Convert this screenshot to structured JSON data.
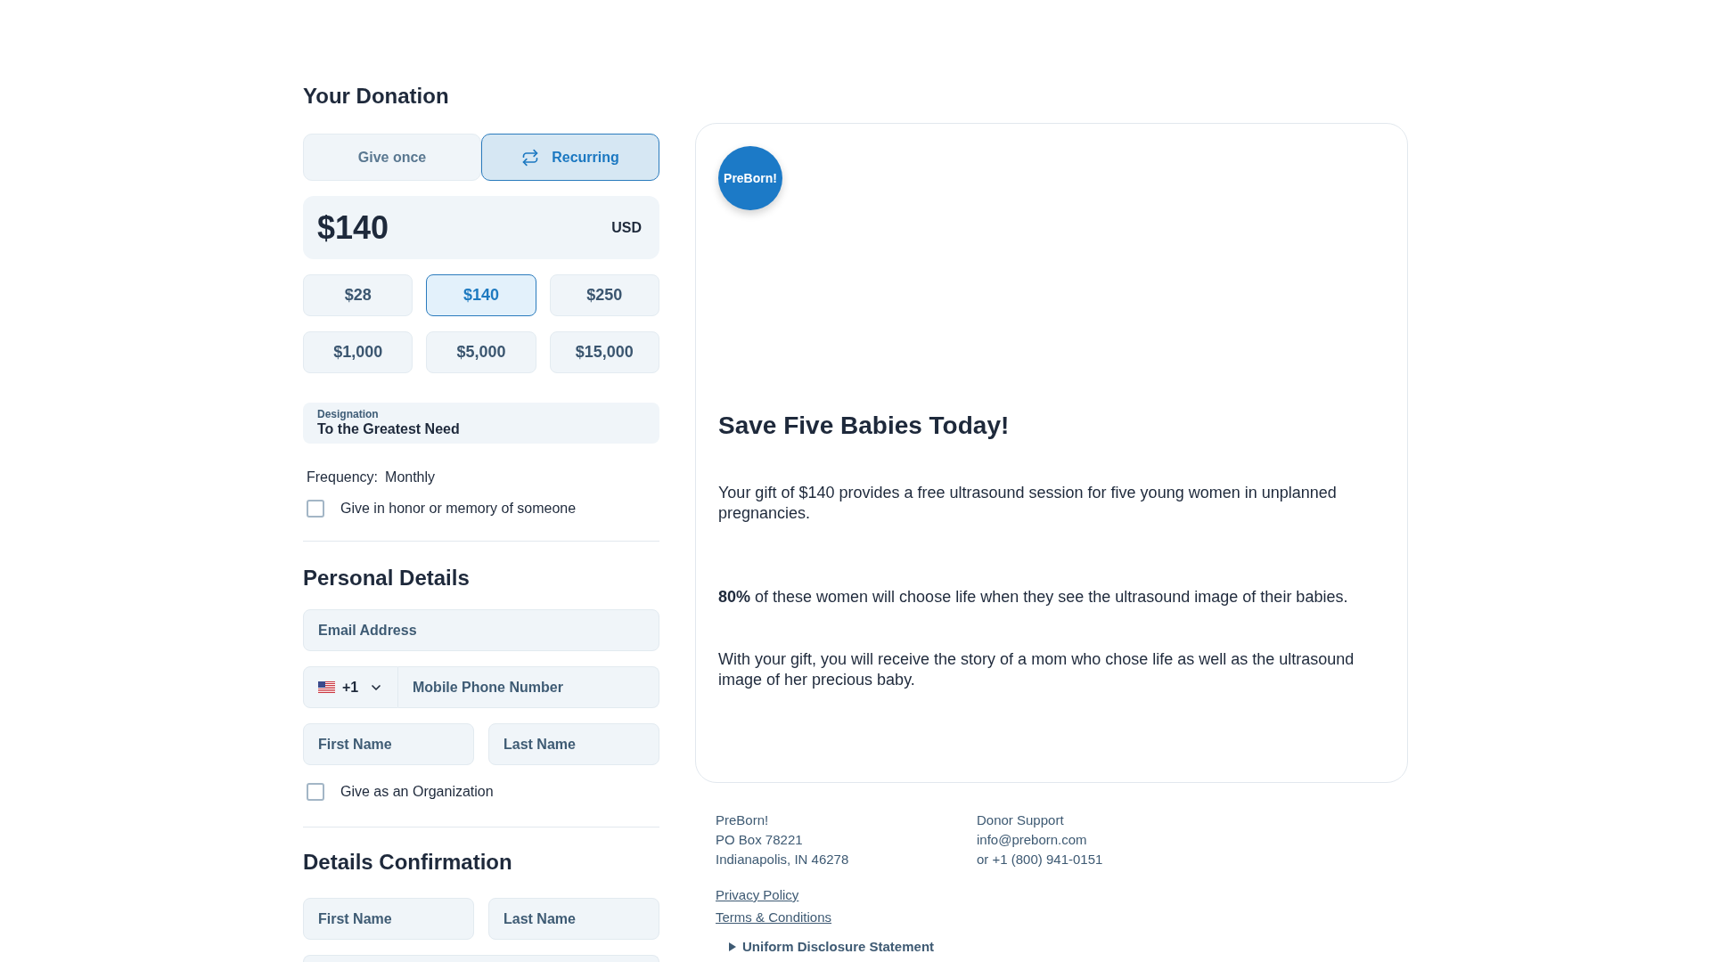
{
  "donation": {
    "title": "Your Donation",
    "frequency_tabs": [
      {
        "label": "Give once",
        "selected": false,
        "kind": "once"
      },
      {
        "label": "Recurring",
        "selected": true,
        "kind": "recurring"
      }
    ],
    "amount": {
      "value": "$140",
      "currency": "USD"
    },
    "presets": [
      {
        "label": "$28",
        "selected": false
      },
      {
        "label": "$140",
        "selected": true
      },
      {
        "label": "$250",
        "selected": false
      },
      {
        "label": "$1,000",
        "selected": false
      },
      {
        "label": "$5,000",
        "selected": false
      },
      {
        "label": "$15,000",
        "selected": false
      }
    ],
    "designation": {
      "label": "Designation",
      "value": "To the Greatest Need"
    },
    "frequency": {
      "label": "Frequency:",
      "value": "Monthly"
    },
    "tribute": {
      "label": "Give in honor or memory of someone",
      "checked": false
    }
  },
  "personal_details": {
    "title": "Personal Details",
    "email": {
      "placeholder": "Email Address"
    },
    "phone": {
      "country_code": "+1",
      "placeholder": "Mobile Phone Number"
    },
    "first_name": {
      "placeholder": "First Name"
    },
    "last_name": {
      "placeholder": "Last Name"
    },
    "organization": {
      "label": "Give as an Organization",
      "checked": false
    }
  },
  "details_confirmation": {
    "title": "Details Confirmation",
    "first_name": {
      "placeholder": "First Name"
    },
    "last_name": {
      "placeholder": "Last Name"
    }
  },
  "campaign": {
    "logo_text": "PreBorn!",
    "title": "Save Five Babies Today!",
    "paragraphs": [
      "Your gift of $140 provides a free ultrasound session for five young women in unplanned pregnancies.",
      "**80%** of these women will choose life when they see the ultrasound image of their babies.",
      "With your gift, you will receive the story of a mom who chose life as well as the ultrasound image of her precious baby."
    ]
  },
  "footer": {
    "address": [
      "PreBorn!",
      "PO Box 78221",
      "Indianapolis, IN 46278"
    ],
    "support": [
      "Donor Support",
      "info@preborn.com",
      "or +1 (800) 941-0151"
    ],
    "links": [
      "Privacy Policy",
      "Terms & Conditions"
    ],
    "disclosure": {
      "label": "Uniform Disclosure Statement",
      "expanded": false
    }
  }
}
